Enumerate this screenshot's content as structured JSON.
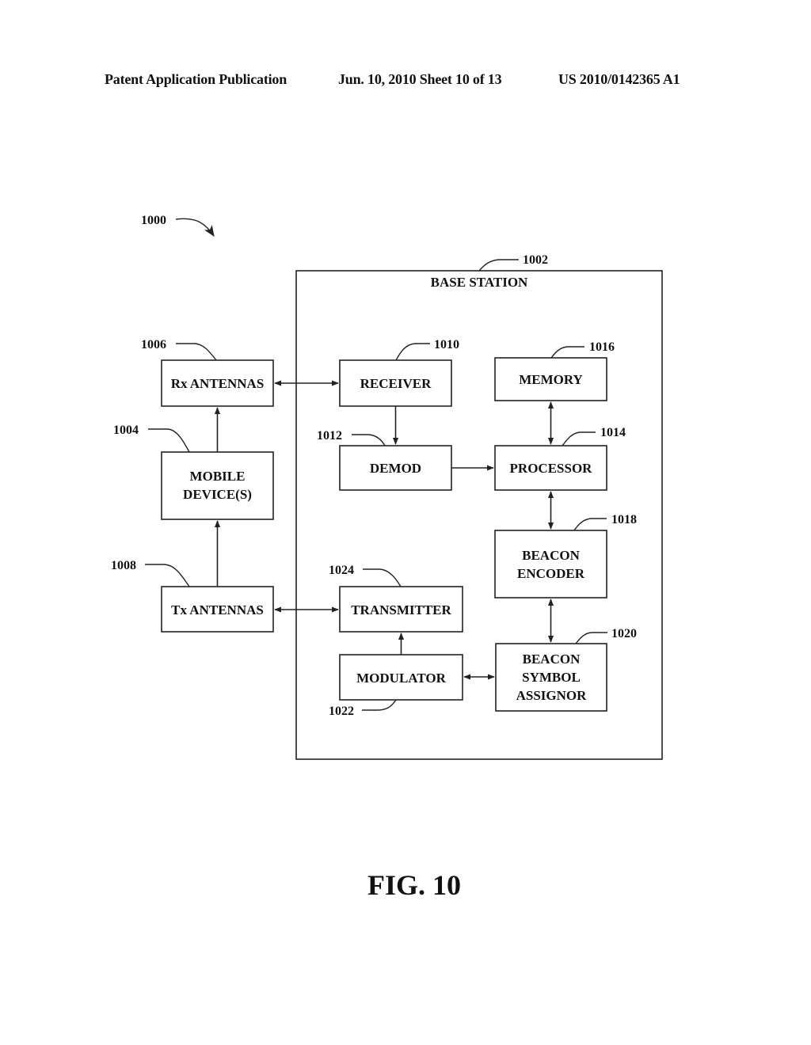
{
  "header": {
    "publication": "Patent Application Publication",
    "date_sheet": "Jun. 10, 2010  Sheet 10 of 13",
    "number": "US 2010/0142365 A1"
  },
  "figure": {
    "ref": "1000",
    "caption": "FIG. 10"
  },
  "base_station": {
    "ref": "1002",
    "title": "BASE STATION"
  },
  "blocks": {
    "rx_antennas": {
      "ref": "1006",
      "lines": [
        "Rx ANTENNAS"
      ]
    },
    "mobile_devices": {
      "ref": "1004",
      "lines": [
        "MOBILE",
        "DEVICE(S)"
      ]
    },
    "tx_antennas": {
      "ref": "1008",
      "lines": [
        "Tx ANTENNAS"
      ]
    },
    "receiver": {
      "ref": "1010",
      "lines": [
        "RECEIVER"
      ]
    },
    "demod": {
      "ref": "1012",
      "lines": [
        "DEMOD"
      ]
    },
    "memory": {
      "ref": "1016",
      "lines": [
        "MEMORY"
      ]
    },
    "processor": {
      "ref": "1014",
      "lines": [
        "PROCESSOR"
      ]
    },
    "beacon_encoder": {
      "ref": "1018",
      "lines": [
        "BEACON",
        "ENCODER"
      ]
    },
    "transmitter": {
      "ref": "1024",
      "lines": [
        "TRANSMITTER"
      ]
    },
    "modulator": {
      "ref": "1022",
      "lines": [
        "MODULATOR"
      ]
    },
    "beacon_symbol_assignor": {
      "ref": "1020",
      "lines": [
        "BEACON",
        "SYMBOL",
        "ASSIGNOR"
      ]
    }
  }
}
